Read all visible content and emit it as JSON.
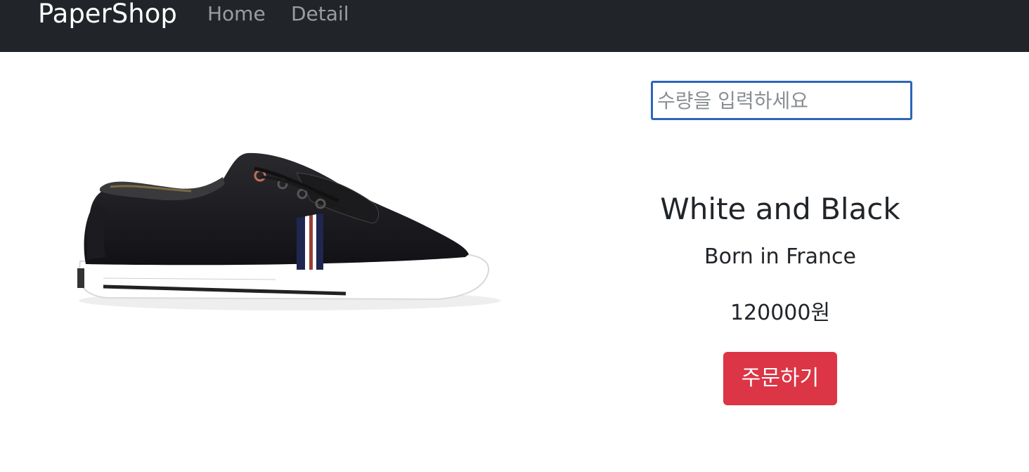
{
  "navbar": {
    "brand": "PaperShop",
    "links": [
      "Home",
      "Detail"
    ],
    "background": "#212529"
  },
  "product": {
    "image_icon": "sneaker-image",
    "quantity_placeholder": "수량을 입력하세요",
    "quantity_value": "",
    "title": "White and Black",
    "content": "Born in France",
    "price": "120000원",
    "order_label": "주문하기",
    "order_color": "#dc3545",
    "input_focus_color": "#2b66b8"
  }
}
